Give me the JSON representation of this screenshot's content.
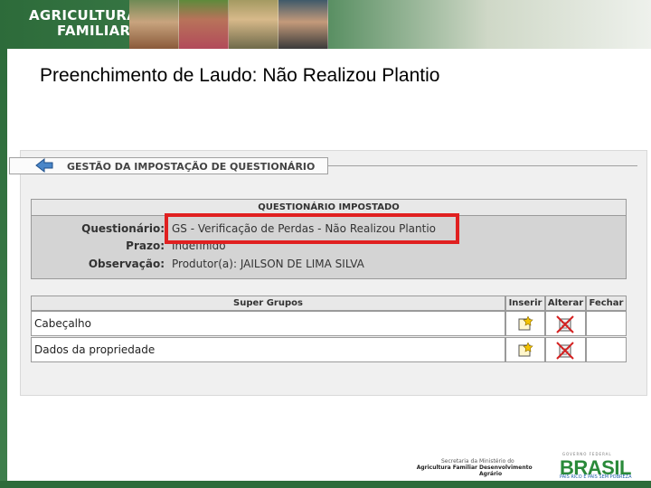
{
  "banner": {
    "line1": "AGRICULTURA",
    "line2": "FAMILIAR"
  },
  "slide_title": "Preenchimento de Laudo: Não Realizou Plantio",
  "section_header": "GESTÃO DA IMPOSTAÇÃO DE QUESTIONÁRIO",
  "questionnaire": {
    "heading": "QUESTIONÁRIO IMPOSTADO",
    "fields": [
      {
        "label": "Questionário:",
        "value": "GS - Verificação de Perdas - Não Realizou Plantio"
      },
      {
        "label": "Prazo:",
        "value": "Indefinido"
      },
      {
        "label": "Observação:",
        "value": "Produtor(a): JAILSON DE LIMA SILVA"
      }
    ]
  },
  "grid": {
    "columns": [
      "Super Grupos",
      "Inserir",
      "Alterar",
      "Fechar"
    ],
    "rows": [
      {
        "name": "Cabeçalho"
      },
      {
        "name": "Dados da propriedade"
      }
    ]
  },
  "footer": {
    "logo1_line1": "Secretaria da",
    "logo1_line2": "Agricultura Familiar",
    "logo2_line1": "Ministério do",
    "logo2_line2": "Desenvolvimento Agrário",
    "gov_label": "GOVERNO FEDERAL",
    "brasil": "BRASIL",
    "brasil_sub": "PAÍS RICO É PAÍS SEM POBREZA"
  },
  "colors": {
    "highlight": "#e02020",
    "brand_green": "#2d6b3a"
  }
}
